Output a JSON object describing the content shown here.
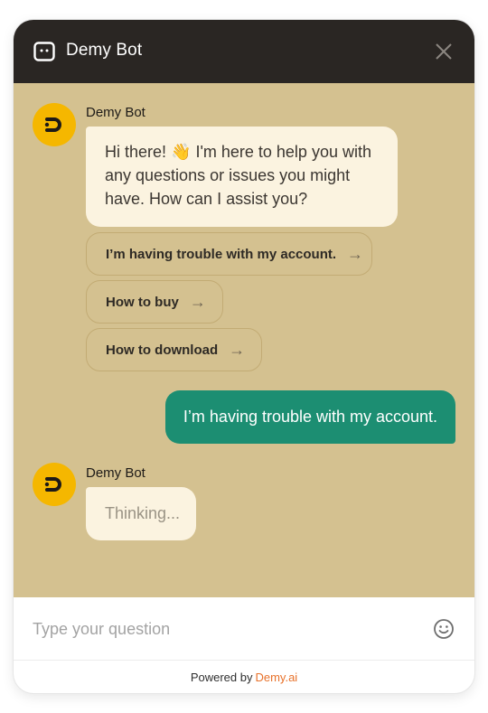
{
  "header": {
    "title": "Demy Bot",
    "bot_icon": "robot-face-icon",
    "close_icon": "close-icon"
  },
  "messages": {
    "bot_greeting": {
      "sender": "Demy Bot",
      "text": "Hi there! 👋 I'm here to help you with any questions or issues you might have. How can I assist you?"
    },
    "suggestions": [
      {
        "label": "I’m having trouble with my account.",
        "arrow": "→"
      },
      {
        "label": "How to buy",
        "arrow": "→"
      },
      {
        "label": "How to download",
        "arrow": "→"
      }
    ],
    "user_message": {
      "text": "I’m having trouble with my account."
    },
    "bot_reply": {
      "sender": "Demy Bot",
      "text": "Thinking..."
    }
  },
  "input": {
    "placeholder": "Type your question",
    "emoji_icon": "smiley-face-icon"
  },
  "footer": {
    "prefix": "Powered by",
    "brand": "Demy.ai"
  },
  "colors": {
    "header_bg": "#2a2623",
    "chat_bg": "#d4c190",
    "bot_bubble": "#fbf3e0",
    "user_bubble": "#1c8e72",
    "avatar": "#f5b700",
    "brand_link": "#e8722b"
  }
}
